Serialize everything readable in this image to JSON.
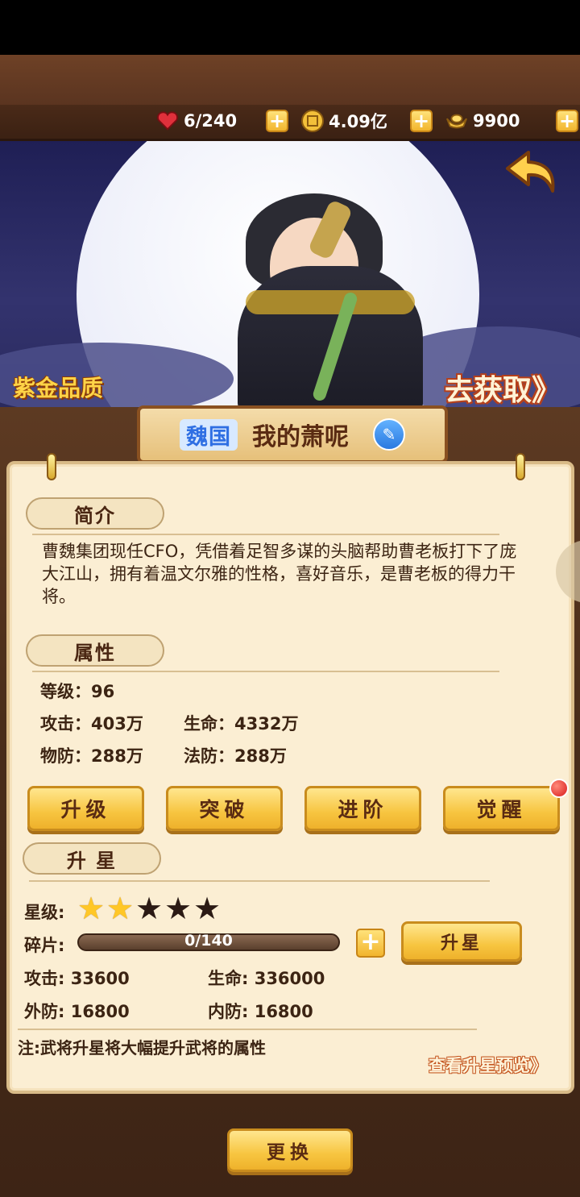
{
  "resources": {
    "stamina": "6/240",
    "gold": "4.09亿",
    "ingots": "9900"
  },
  "banner": {
    "quality": "紫金品质",
    "get_link": "去获取》"
  },
  "hero": {
    "kingdom": "魏国",
    "name": "我的萧呢"
  },
  "intro": {
    "title": "简介",
    "text": "曹魏集团现任CFO，凭借着足智多谋的头脑帮助曹老板打下了庞大江山，拥有着温文尔雅的性格，喜好音乐，是曹老板的得力干将。"
  },
  "attributes": {
    "title": "属性",
    "level": "等级：96",
    "attack": "攻击：403万",
    "hp": "生命：4332万",
    "pdef": "物防：288万",
    "mdef": "法防：288万"
  },
  "actions": {
    "upgrade": "升级",
    "breakthrough": "突破",
    "advance": "进阶",
    "awaken": "觉醒"
  },
  "star_up": {
    "title": "升 星",
    "star_label": "星级:",
    "stars_filled": 2,
    "stars_total": 5,
    "fragment_label": "碎片:",
    "fragment_progress": "0/140",
    "fragment_ratio": 0.0,
    "button": "升星",
    "attack": "攻击: 33600",
    "hp": "生命: 336000",
    "outer_def": "外防: 16800",
    "inner_def": "内防: 16800",
    "note": "注:武将升星将大幅提升武将的属性",
    "preview_link": "查看升星预览》"
  },
  "footer": {
    "swap_button": "更换"
  }
}
